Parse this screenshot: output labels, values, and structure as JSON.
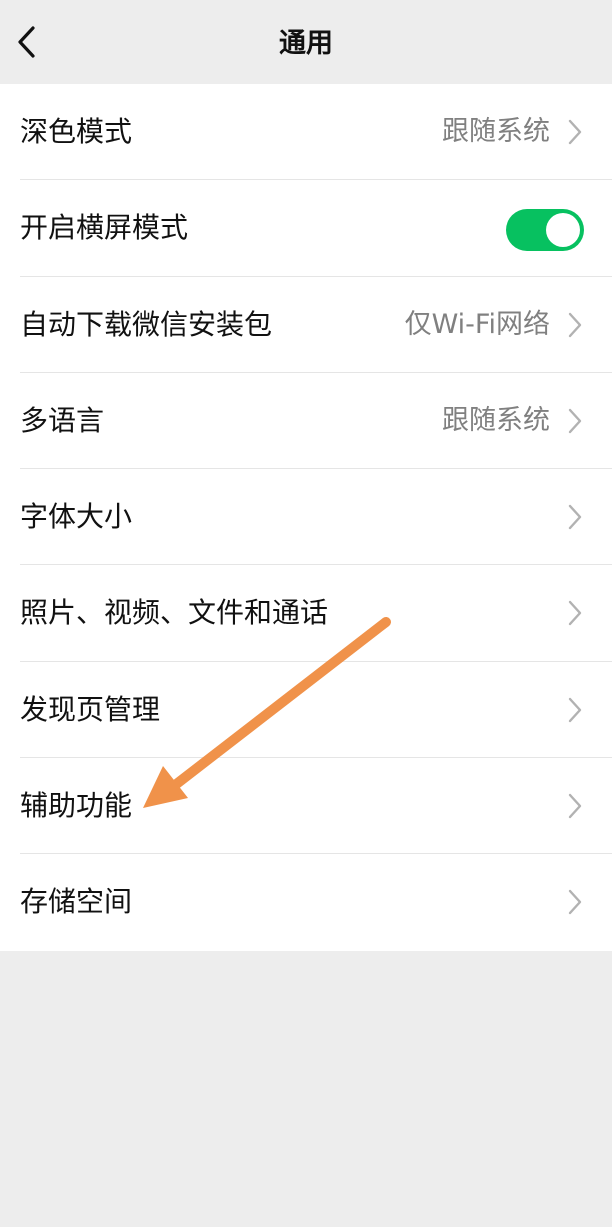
{
  "header": {
    "title": "通用",
    "back_icon": "chevron-left-icon"
  },
  "settings": [
    {
      "id": "dark-mode",
      "label": "深色模式",
      "value": "跟随系统",
      "control": "chevron"
    },
    {
      "id": "landscape-mode",
      "label": "开启横屏模式",
      "value": "",
      "control": "toggle",
      "toggle_on": true
    },
    {
      "id": "auto-download",
      "label": "自动下载微信安装包",
      "value": "仅Wi-Fi网络",
      "control": "chevron"
    },
    {
      "id": "language",
      "label": "多语言",
      "value": "跟随系统",
      "control": "chevron"
    },
    {
      "id": "font-size",
      "label": "字体大小",
      "value": "",
      "control": "chevron"
    },
    {
      "id": "media-files",
      "label": "照片、视频、文件和通话",
      "value": "",
      "control": "chevron"
    },
    {
      "id": "discover-manage",
      "label": "发现页管理",
      "value": "",
      "control": "chevron"
    },
    {
      "id": "accessibility",
      "label": "辅助功能",
      "value": "",
      "control": "chevron"
    },
    {
      "id": "storage",
      "label": "存储空间",
      "value": "",
      "control": "chevron"
    }
  ],
  "colors": {
    "toggle_on": "#07c160",
    "annotation_arrow": "#f0924a",
    "background": "#ededed"
  }
}
